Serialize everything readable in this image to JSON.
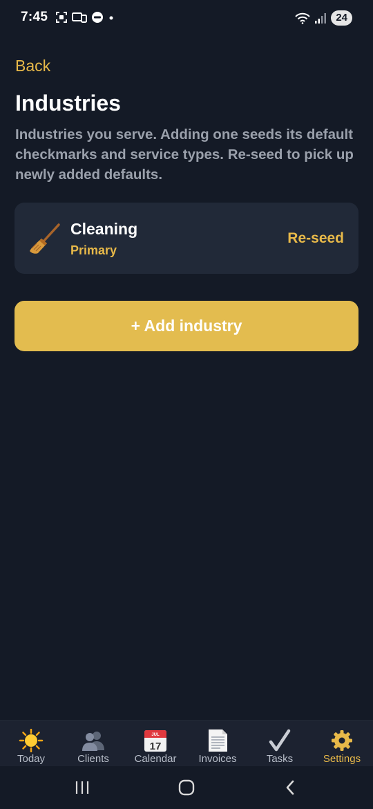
{
  "status_bar": {
    "time": "7:45",
    "battery": "24"
  },
  "header": {
    "back_label": "Back",
    "title": "Industries",
    "description": "Industries you serve. Adding one seeds its default checkmarks and service types. Re-seed to pick up newly added defaults."
  },
  "industries": [
    {
      "name": "Cleaning",
      "badge": "Primary",
      "icon": "broom-icon",
      "action_label": "Re-seed"
    }
  ],
  "add_button": {
    "label": "+ Add industry"
  },
  "tabs": [
    {
      "label": "Today",
      "icon": "sun-icon",
      "active": false
    },
    {
      "label": "Clients",
      "icon": "people-icon",
      "active": false
    },
    {
      "label": "Calendar",
      "icon": "calendar-icon",
      "active": false,
      "calendar_month": "JUL",
      "calendar_day": "17"
    },
    {
      "label": "Invoices",
      "icon": "document-icon",
      "active": false
    },
    {
      "label": "Tasks",
      "icon": "checkmark-icon",
      "active": false
    },
    {
      "label": "Settings",
      "icon": "gear-icon",
      "active": true
    }
  ],
  "colors": {
    "background": "#141a26",
    "card": "#212938",
    "accent": "#e8b949",
    "button": "#e3bc4f",
    "muted_text": "#9aa0ab"
  }
}
